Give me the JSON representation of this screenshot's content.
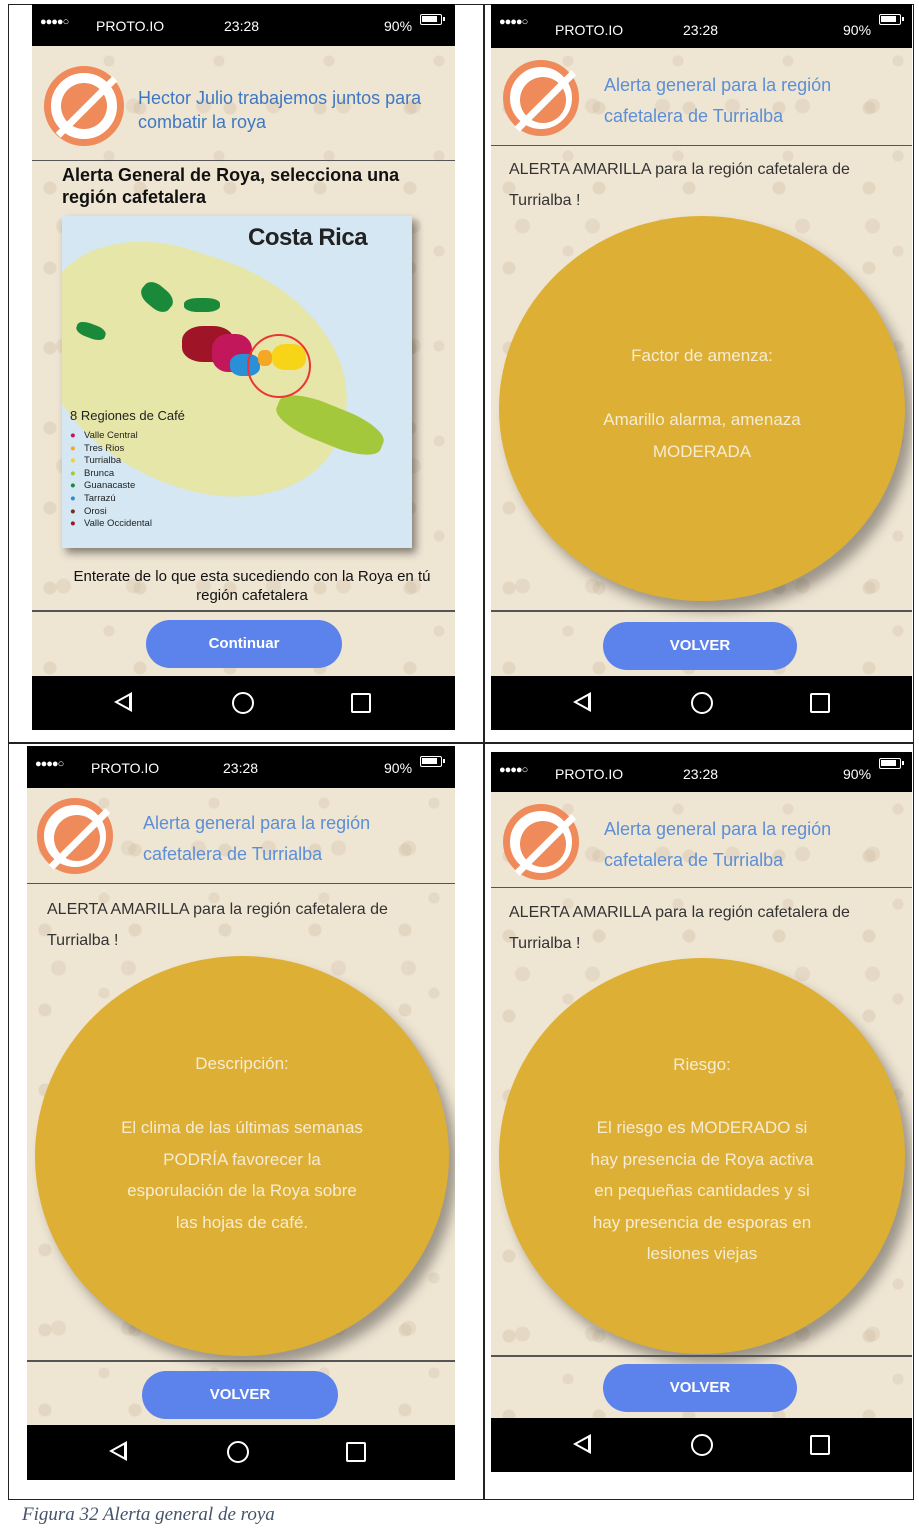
{
  "status": {
    "carrier": "PROTO.IO",
    "time": "23:28",
    "battery": "90%",
    "dots": "●●●●○"
  },
  "screen1": {
    "title": "Hector Julio trabajemos juntos para combatir la roya",
    "heading": "Alerta General de Roya, selecciona una región cafetalera",
    "map_title": "Costa Rica",
    "legend_title": "8 Regiones de Café",
    "regions": [
      {
        "name": "Valle Central",
        "color": "#c2185b"
      },
      {
        "name": "Tres Rios",
        "color": "#f5a623"
      },
      {
        "name": "Turrialba",
        "color": "#f7d417"
      },
      {
        "name": "Brunca",
        "color": "#a4c83c"
      },
      {
        "name": "Guanacaste",
        "color": "#1a8a3a"
      },
      {
        "name": "Tarrazú",
        "color": "#2a8fd6"
      },
      {
        "name": "Orosi",
        "color": "#7b2a1e"
      },
      {
        "name": "Valle Occidental",
        "color": "#a01428"
      }
    ],
    "subtext": "Enterate de lo que esta sucediendo con la Roya en tú región cafetalera",
    "button": "Continuar"
  },
  "alert_title": "Alerta general para la región cafetalera de Turrialba",
  "alert_text": "ALERTA AMARILLA para la región cafetalera de Turrialba !",
  "back_button": "VOLVER",
  "screen2": {
    "label": "Factor de amenza:",
    "body": "Amarillo alarma, amenaza MODERADA"
  },
  "screen3": {
    "label": "Descripción:",
    "body": "El clima de las últimas semanas PODRÍA favorecer la esporulación de la Roya sobre las hojas de café."
  },
  "screen4": {
    "label": "Riesgo:",
    "body": "El riesgo es MODERADO si hay presencia de Roya activa en pequeñas cantidades y si hay presencia de esporas en lesiones viejas"
  },
  "caption": "Figura 32 Alerta general de roya",
  "colors": {
    "accent": "#5c83ec",
    "alert_circle": "#deaf35",
    "logo": "#ef8a5a"
  }
}
